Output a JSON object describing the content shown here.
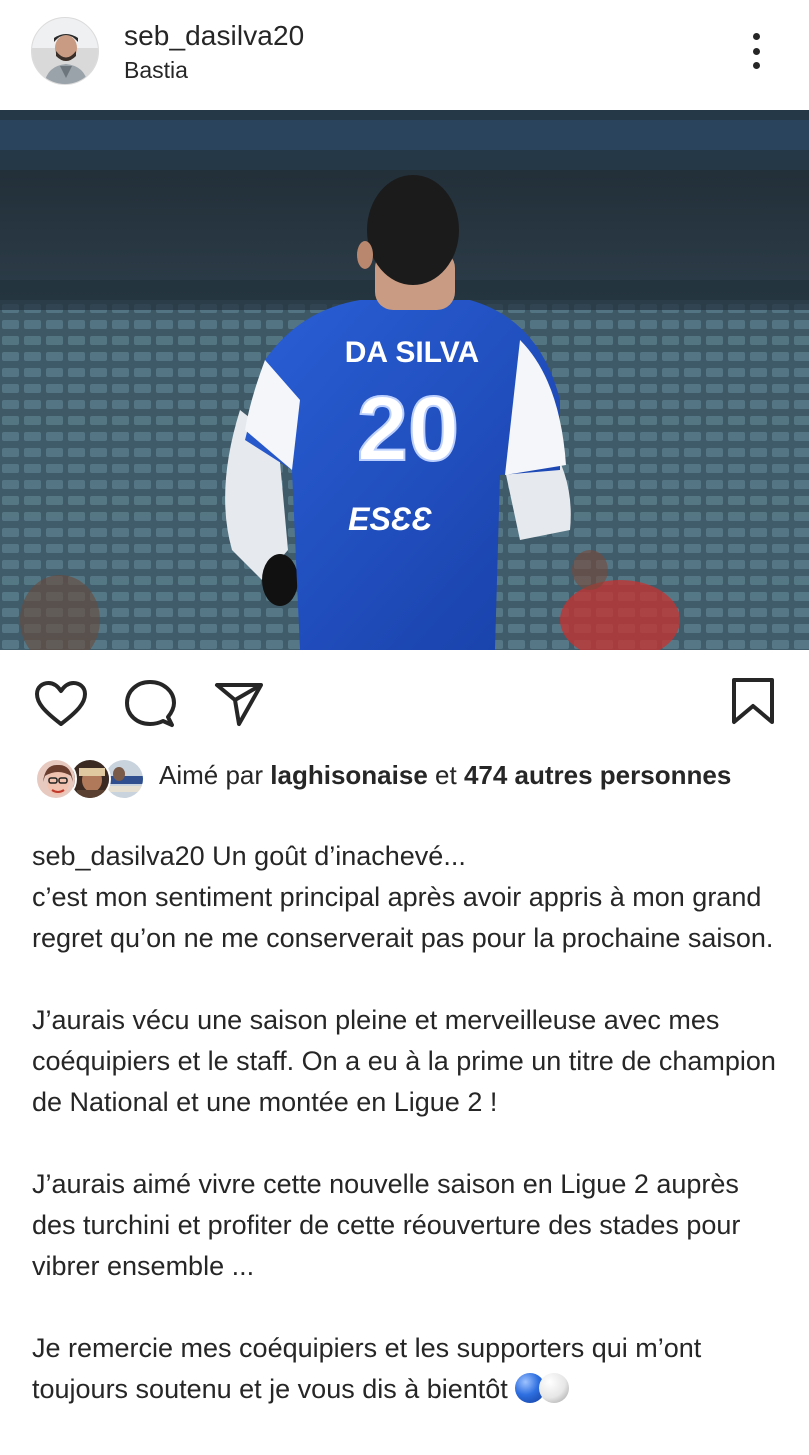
{
  "header": {
    "username": "seb_dasilva20",
    "location": "Bastia"
  },
  "photo": {
    "jersey_name": "DA SILVA",
    "jersey_number": "20",
    "jersey_sponsor": "ESƐƐ"
  },
  "actions": {
    "icons": [
      "heart-icon",
      "comment-icon",
      "share-icon",
      "bookmark-icon"
    ]
  },
  "likes": {
    "prefix": "Aimé par",
    "liker": "laghisonaise",
    "connector": "et",
    "others": "474 autres personnes"
  },
  "caption": {
    "username": "seb_dasilva20",
    "first_line": "Un goût d’inachevé...",
    "para1": "c’est mon sentiment principal après avoir appris à mon grand regret qu’on ne me conserverait pas pour la prochaine saison.",
    "para2": "J’aurais vécu une saison pleine et merveilleuse avec mes coéquipiers et le staff. On a eu à la prime un titre de champion de National et une montée en Ligue 2 !",
    "para3": "J’aurais aimé vivre cette nouvelle saison en Ligue 2 auprès des turchini et profiter de cette réouverture des stades pour vibrer ensemble ...",
    "para4": "Je remercie mes coéquipiers et les supporters qui m’ont toujours soutenu et je vous dis à bientôt"
  },
  "colors": {
    "text": "#262626",
    "jersey_blue": "#1f4fc4",
    "background": "#ffffff"
  }
}
